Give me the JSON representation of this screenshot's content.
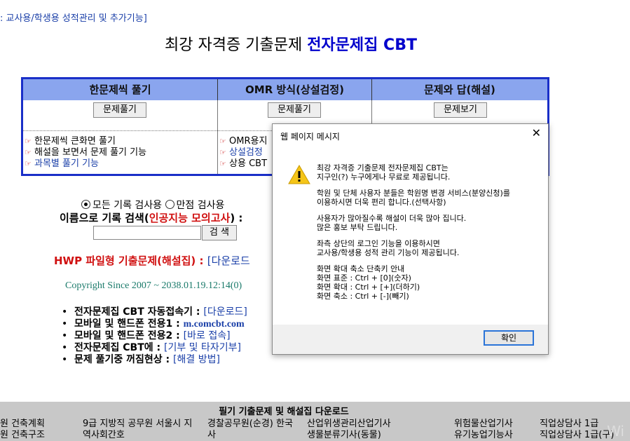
{
  "top_link": ": 교사용/학생용 성적관리 및 추가기능]",
  "title": {
    "main": "최강 자격증 기출문제",
    "highlight": "전자문제집 CBT"
  },
  "columns": [
    {
      "header": "한문제씩 풀기",
      "button": "문제풀기"
    },
    {
      "header": "OMR 방식(상설검정)",
      "button": "문제풀기"
    },
    {
      "header": "문제와 답(해설)",
      "button": "문제보기"
    }
  ],
  "col1_bullets": [
    "한문제씩 큰화면 풀기",
    "해설을 보면서 문제 풀기 기능",
    "과목별 풀기 기능"
  ],
  "col2_bullets": [
    "OMR용지",
    "상설검정",
    "상용 CBT"
  ],
  "search": {
    "radio_all": "모든 기록 검사용",
    "radio_full": "만점 검사용",
    "label_prefix": "이름으로 기록 검색(",
    "label_red": "인공지능 모의고사",
    "label_suffix": ") :",
    "button": "검 색",
    "value": ""
  },
  "hwp": {
    "label": "HWP 파일형 기출문제(해설집) :",
    "link": "[다운로드"
  },
  "copyright": "Copyright Since 2007 ~ 2038.01.19.12:14(0)",
  "info": [
    {
      "label": "전자문제집 CBT 자동접속기 :",
      "link": "[다운로드]",
      "bold_link": false
    },
    {
      "label": "모바일 및 핸드폰 전용1 :",
      "link": "m.comcbt.com",
      "bold_link": true
    },
    {
      "label": "모바일 및 핸드폰 전용2 :",
      "link": "[바로 접속]",
      "bold_link": false
    },
    {
      "label": "전자문제집 CBT에 :",
      "link": "[기부 및 타자기부]",
      "bold_link": false
    },
    {
      "label": "문제 풀기중 꺼짐현상 :",
      "link": "[해결 방법]",
      "bold_link": false
    }
  ],
  "bottom": {
    "title": "필기 기출문제 및 해설집 다운로드",
    "cols": [
      [
        "원 건축계획",
        "원 건축구조"
      ],
      [
        "9급 지방직 공무원 서울시 지",
        "역사회간호"
      ],
      [
        "경찰공무원(순경) 한국",
        "사"
      ],
      [
        "산업위생관리산업기사",
        "생물분류기사(동물)"
      ],
      [
        "위험물산업기사",
        "유기농업기능사"
      ],
      [
        "직업상담사 1급",
        "직업상담사 1급(구)"
      ]
    ],
    "watermark": "Wi"
  },
  "dialog": {
    "title": "웹 페이지 메시지",
    "close": "✕",
    "paragraphs": [
      [
        "최강 자격증 기출문제 전자문제집 CBT는",
        "지구인(?) 누구에게나 무료로 제공됩니다."
      ],
      [
        "학원 및 단체 사용자 분들은 학원명 변경 서비스(분양신청)를",
        "이용하시면 더욱 편리 합니다.(선택사항)"
      ],
      [
        "사용자가 많아질수록 해설이 더욱 많아 집니다.",
        "많은 홍보 부탁 드립니다."
      ],
      [
        "좌측 상단의 로그인 기능을 이용하시면",
        "교사용/학생용 성적 관리 기능이 제공됩니다."
      ],
      [
        "화면 확대 축소 단축키 안내",
        "화면 표준 : Ctrl + [0](숫자)",
        "화면 확대 : Ctrl + [+](더하기)",
        "화면 축소 : Ctrl + [-](빼기)"
      ]
    ],
    "ok": "확인"
  }
}
